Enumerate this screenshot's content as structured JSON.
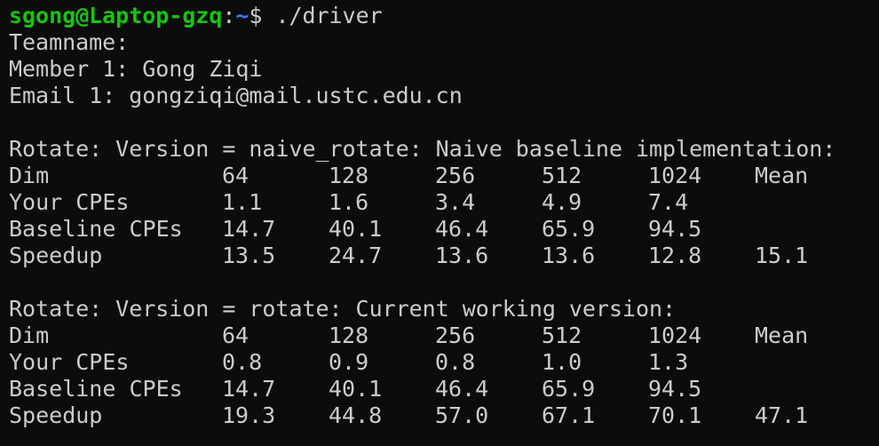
{
  "prompt": {
    "user_host": "sgong@Laptop-gzq",
    "sep": ":",
    "path": "~",
    "symbol": "$ ",
    "command": "./driver"
  },
  "team": {
    "teamname": "Teamname:",
    "member": "Member 1: Gong Ziqi",
    "email": "Email 1: gongziqi@mail.ustc.edu.cn"
  },
  "sections": [
    {
      "title": "Rotate: Version = naive_rotate: Naive baseline implementation:",
      "rows": [
        [
          "Dim",
          "64",
          "128",
          "256",
          "512",
          "1024",
          "Mean"
        ],
        [
          "Your CPEs",
          "1.1",
          "1.6",
          "3.4",
          "4.9",
          "7.4",
          ""
        ],
        [
          "Baseline CPEs",
          "14.7",
          "40.1",
          "46.4",
          "65.9",
          "94.5",
          ""
        ],
        [
          "Speedup",
          "13.5",
          "24.7",
          "13.6",
          "13.6",
          "12.8",
          "15.1"
        ]
      ]
    },
    {
      "title": "Rotate: Version = rotate: Current working version:",
      "rows": [
        [
          "Dim",
          "64",
          "128",
          "256",
          "512",
          "1024",
          "Mean"
        ],
        [
          "Your CPEs",
          "0.8",
          "0.9",
          "0.8",
          "1.0",
          "1.3",
          ""
        ],
        [
          "Baseline CPEs",
          "14.7",
          "40.1",
          "46.4",
          "65.9",
          "94.5",
          ""
        ],
        [
          "Speedup",
          "19.3",
          "44.8",
          "57.0",
          "67.1",
          "70.1",
          "47.1"
        ]
      ]
    }
  ],
  "colors": {
    "background": "#0c0c0c",
    "foreground": "#cccccc",
    "prompt_user": "#16c60c",
    "prompt_path": "#3b78ff"
  }
}
